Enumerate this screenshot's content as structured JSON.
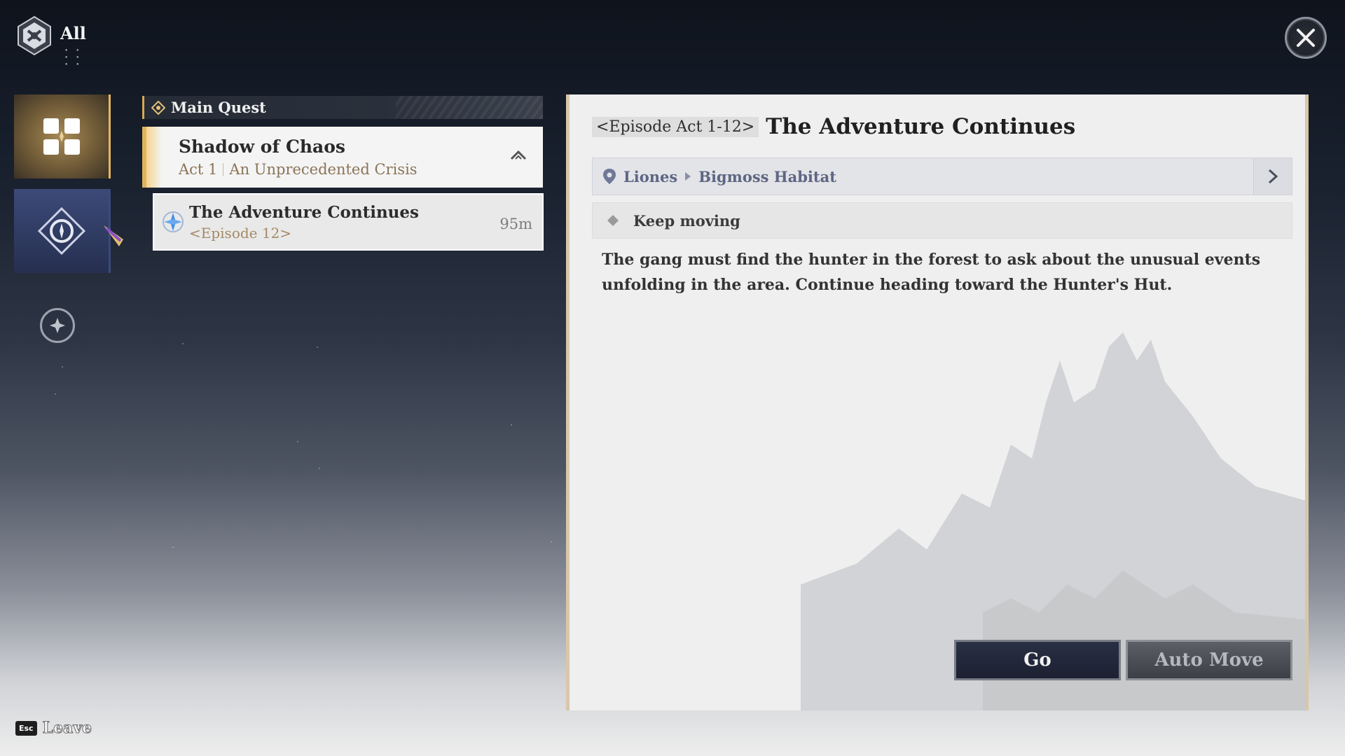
{
  "header": {
    "title": "All",
    "logo_icon": "crest-logo-icon",
    "close_icon": "close-icon"
  },
  "tabs": [
    {
      "icon": "grid-quests-icon",
      "active": true
    },
    {
      "icon": "compass-diamond-icon",
      "active": false
    },
    {
      "icon": "plus-circle-icon",
      "active": false
    }
  ],
  "quest_list": {
    "section_label": "Main Quest",
    "chapter": {
      "name": "Shadow of Chaos",
      "act": "Act 1",
      "act_title": "An Unprecedented Crisis"
    },
    "quests": [
      {
        "name": "The Adventure Continues",
        "episode": "<Episode 12>",
        "distance": "95m"
      }
    ]
  },
  "details": {
    "episode_tag": "<Episode Act 1-12>",
    "title": "The Adventure Continues",
    "location": {
      "region": "Liones",
      "area": "Bigmoss Habitat"
    },
    "objective": "Keep moving",
    "description": "The gang must find the hunter in the forest to ask about the unusual events unfolding in the area. Continue heading toward the Hunter's Hut.",
    "go_label": "Go",
    "auto_move_label": "Auto Move"
  },
  "footer": {
    "key": "Esc",
    "leave_label": "Leave"
  },
  "colors": {
    "accent_gold": "#e0b35d",
    "location_text": "#5e6683",
    "episode_text": "#a58a66"
  }
}
